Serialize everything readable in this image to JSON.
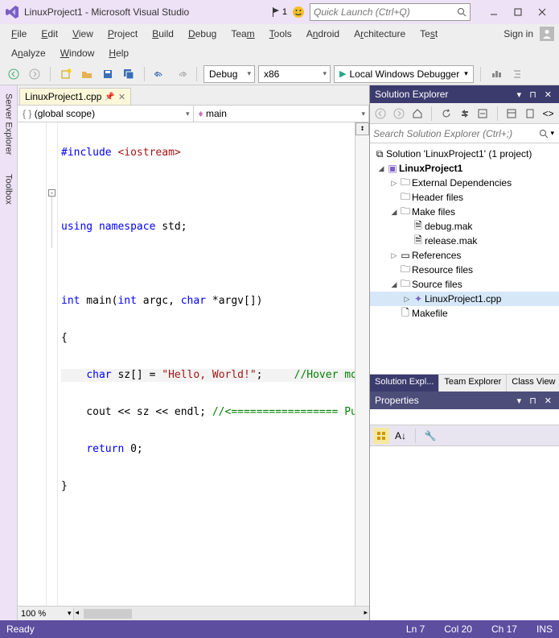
{
  "title": "LinuxProject1 - Microsoft Visual Studio",
  "notification_count": "1",
  "quick_launch_placeholder": "Quick Launch (Ctrl+Q)",
  "signin": "Sign in",
  "menubar": [
    "File",
    "Edit",
    "View",
    "Project",
    "Build",
    "Debug",
    "Team",
    "Tools",
    "Android",
    "Architecture",
    "Test"
  ],
  "menubar2": [
    "Analyze",
    "Window",
    "Help"
  ],
  "toolbar": {
    "config": "Debug",
    "platform": "x86",
    "debug_target": "Local Windows Debugger"
  },
  "left_rail": [
    "Server Explorer",
    "Toolbox"
  ],
  "document_tab": "LinuxProject1.cpp",
  "scope_left": "(global scope)",
  "scope_right": "main",
  "code": {
    "l1a": "#include ",
    "l1b": "<iostream>",
    "l3a": "using namespace",
    "l3b": " std;",
    "l5a": "int",
    "l5b": " main(",
    "l5c": "int",
    "l5d": " argc, ",
    "l5e": "char",
    "l5f": " *argv[])",
    "l6": "{",
    "l7a": "    ",
    "l7b": "char",
    "l7c": " sz[] = ",
    "l7d": "\"Hello, World!\"",
    "l7e": ";     ",
    "l7f": "//Hover mouse o",
    "l8a": "    cout << sz << endl; ",
    "l8b": "//<================= Put a",
    "l9a": "    ",
    "l9b": "return",
    "l9c": " 0;",
    "l10": "}"
  },
  "zoom": "100 %",
  "solution_explorer": {
    "title": "Solution Explorer",
    "search_placeholder": "Search Solution Explorer (Ctrl+;)",
    "solution": "Solution 'LinuxProject1' (1 project)",
    "project": "LinuxProject1",
    "nodes": {
      "ext_deps": "External Dependencies",
      "header": "Header files",
      "make": "Make files",
      "debug_mak": "debug.mak",
      "release_mak": "release.mak",
      "refs": "References",
      "resource": "Resource files",
      "source": "Source files",
      "main_cpp": "LinuxProject1.cpp",
      "makefile": "Makefile"
    },
    "bottom_tabs": [
      "Solution Expl...",
      "Team Explorer",
      "Class View"
    ]
  },
  "properties": {
    "title": "Properties"
  },
  "status": {
    "ready": "Ready",
    "ln": "Ln 7",
    "col": "Col 20",
    "ch": "Ch 17",
    "ins": "INS"
  }
}
